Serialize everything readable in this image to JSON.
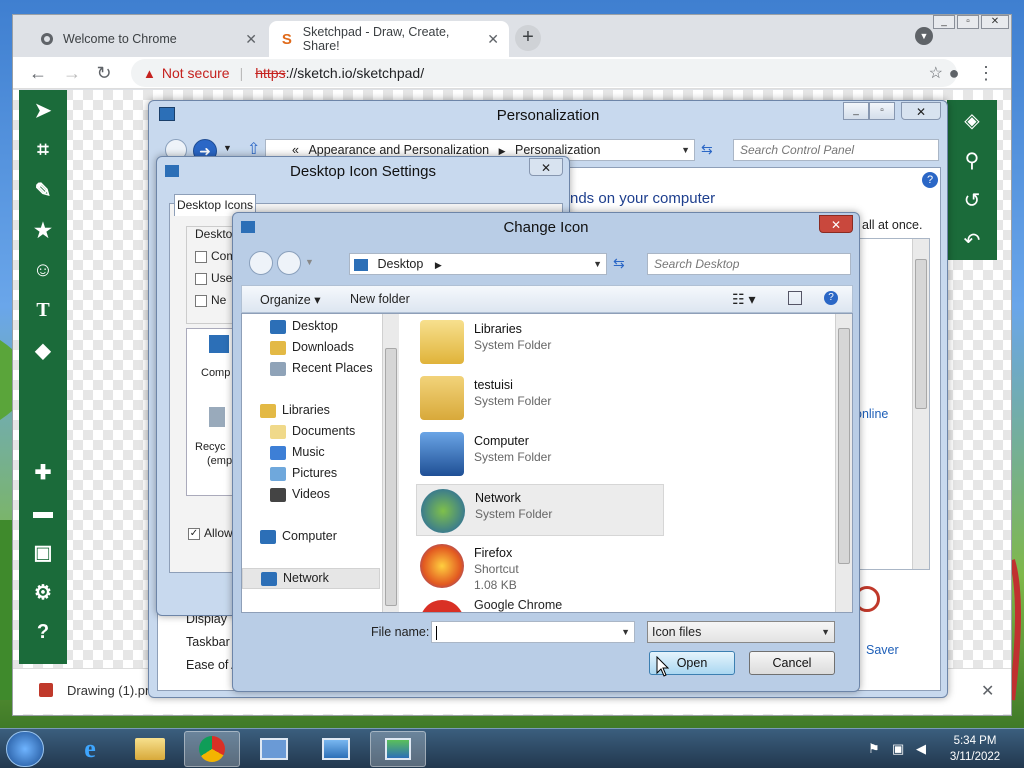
{
  "browser": {
    "tabs": [
      {
        "title": "Welcome to Chrome",
        "icon": "globe-icon"
      },
      {
        "title": "Sketchpad - Draw, Create, Share!",
        "icon": "sketchpad-logo-icon"
      }
    ],
    "new_tab": "+",
    "not_secure": "Not secure",
    "url_scheme": "https",
    "url_rest": "://sketch.io/sketchpad/",
    "download_file": "Drawing (1).pn",
    "download_close": "✕"
  },
  "sketchpad": {
    "left_tools": [
      "pointer-icon",
      "crop-icon",
      "pencil-icon",
      "star-icon",
      "emoji-icon",
      "text-icon",
      "fill-icon",
      "add-icon",
      "folder-icon",
      "save-icon",
      "settings-icon",
      "help-icon"
    ],
    "text_tool": "T",
    "right_tools": [
      "layers-icon",
      "search-icon",
      "history-icon",
      "undo-icon"
    ]
  },
  "personalization": {
    "title": "Personalization",
    "breadcrumb_prefix": "«",
    "breadcrumb": [
      "Appearance and Personalization",
      "Personalization"
    ],
    "search_placeholder": "Search Control Panel",
    "heading_fragment": "nds on your computer",
    "text_fragment": "all at once.",
    "online_link": "online",
    "left_links": [
      "Display",
      "Taskbar",
      "Ease of A"
    ],
    "saver_label": "Saver"
  },
  "desktop_icon_settings": {
    "title": "Desktop Icon Settings",
    "tab": "Desktop Icons",
    "group": "Desktop",
    "checks": [
      "Comp",
      "Use",
      "Ne"
    ],
    "icons": [
      "Comp",
      "Recyc",
      "(emp"
    ],
    "allow": "Allow"
  },
  "change_icon": {
    "title": "Change Icon",
    "address": "Desktop",
    "search_placeholder": "Search Desktop",
    "organize": "Organize",
    "new_folder": "New folder",
    "nav": {
      "favorites": [
        "Desktop",
        "Downloads",
        "Recent Places"
      ],
      "libraries_header": "Libraries",
      "libraries": [
        "Documents",
        "Music",
        "Pictures",
        "Videos"
      ],
      "computer": "Computer",
      "network": "Network"
    },
    "items": [
      {
        "name": "Libraries",
        "type": "System Folder"
      },
      {
        "name": "testuisi",
        "type": "System Folder"
      },
      {
        "name": "Computer",
        "type": "System Folder"
      },
      {
        "name": "Network",
        "type": "System Folder"
      },
      {
        "name": "Firefox",
        "type": "Shortcut",
        "size": "1.08 KB"
      },
      {
        "name": "Google Chrome",
        "type": ""
      }
    ],
    "file_name_label": "File name:",
    "file_name_value": "",
    "filter": "Icon files",
    "open": "Open",
    "cancel": "Cancel"
  },
  "taskbar": {
    "time": "5:34 PM",
    "date": "3/11/2022"
  },
  "colors": {
    "sketch_green": "#1b6b3a",
    "not_secure_red": "#c5221f"
  }
}
